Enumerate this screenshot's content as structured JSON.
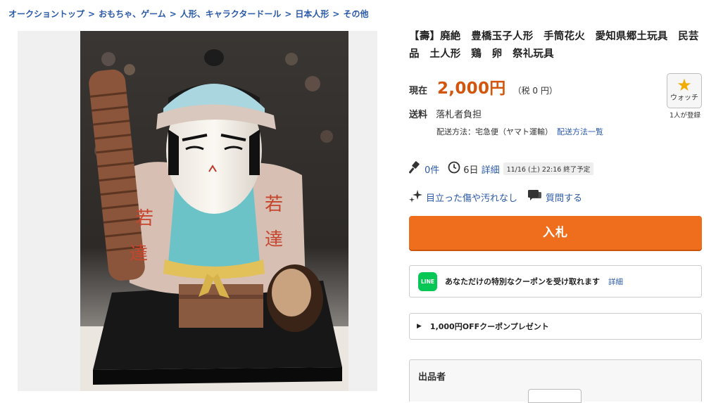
{
  "breadcrumb": {
    "items": [
      "オークショントップ",
      "おもちゃ、ゲーム",
      "人形、キャラクタードール",
      "日本人形",
      "その他"
    ],
    "separator": ">"
  },
  "product": {
    "title": "【壽】廃絶　豊橋玉子人形　手筒花火　愛知県郷土玩具　民芸品　土人形　鶏　卵　祭礼玩具"
  },
  "price": {
    "label": "現在",
    "value": "2,000円",
    "tax": "（税 0 円）"
  },
  "watch": {
    "label": "ウォッチ",
    "count": "1人が登録"
  },
  "shipping": {
    "label": "送料",
    "value": "落札者負担",
    "method": "配送方法：宅急便（ヤマト運輸）",
    "method_link": "配送方法一覧"
  },
  "auction": {
    "bids": "0件",
    "time_left": "6日",
    "detail_link": "詳細",
    "end_time": "11/16 (土) 22:16 終了予定"
  },
  "condition": {
    "text": "目立った傷や汚れなし",
    "question_link": "質問する"
  },
  "bid_button": "入札",
  "line_coupon": {
    "logo": "LINE",
    "text": "あなただけの特別なクーポンを受け取れます",
    "detail": "詳細"
  },
  "coupon": {
    "text": "1,000円OFFクーポンプレゼント"
  },
  "seller": {
    "label": "出品者"
  },
  "photo_characters": [
    "若",
    "達"
  ],
  "colors": {
    "link": "#2b5aa8",
    "price": "#d2560e",
    "bid_button": "#ef6e1e",
    "line_green": "#06c755",
    "watch_star": "#f0ad00"
  }
}
